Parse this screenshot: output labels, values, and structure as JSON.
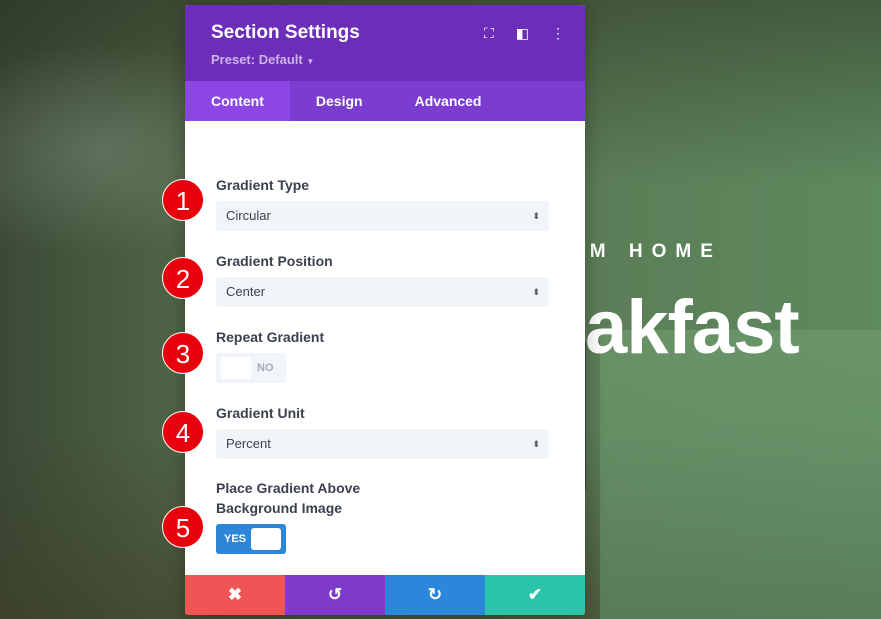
{
  "background": {
    "subtitle": "OM HOME",
    "title": "akfast"
  },
  "panel": {
    "title": "Section Settings",
    "preset": "Preset: Default",
    "tabs": [
      {
        "label": "Content"
      },
      {
        "label": "Design"
      },
      {
        "label": "Advanced"
      }
    ],
    "fields": {
      "gradient_type": {
        "label": "Gradient Type",
        "value": "Circular"
      },
      "gradient_position": {
        "label": "Gradient Position",
        "value": "Center"
      },
      "repeat_gradient": {
        "label": "Repeat Gradient",
        "value": "NO"
      },
      "gradient_unit": {
        "label": "Gradient Unit",
        "value": "Percent"
      },
      "place_above": {
        "label_line1": "Place Gradient Above",
        "label_line2": "Background Image",
        "value": "YES"
      }
    },
    "footer_colors": {
      "cancel": "#ef5555",
      "undo": "#7e3bcb",
      "redo": "#2b87da",
      "save": "#29c4a9"
    }
  },
  "badges": [
    "1",
    "2",
    "3",
    "4",
    "5"
  ]
}
